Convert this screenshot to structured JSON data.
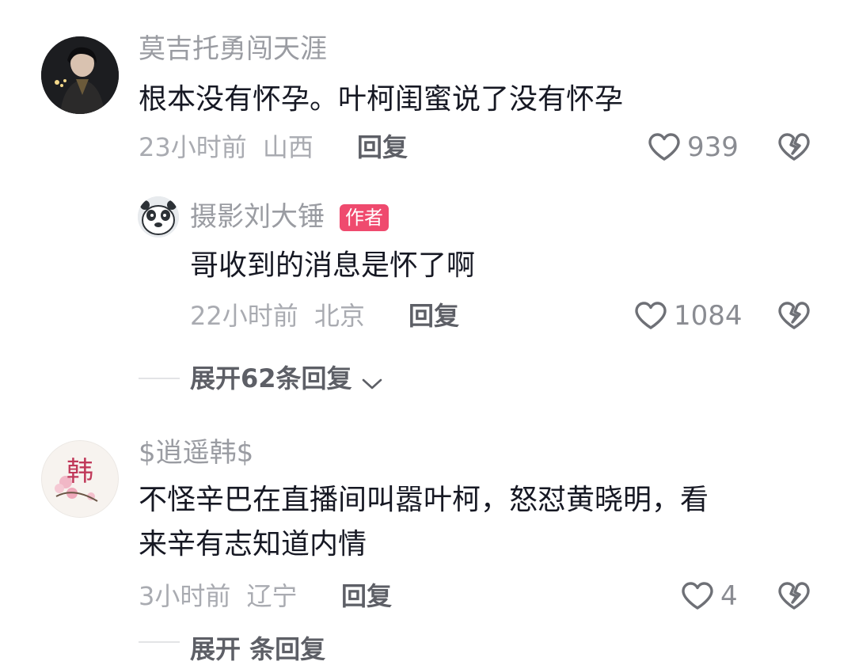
{
  "comments": [
    {
      "username": "莫吉托勇闯天涯",
      "text": "根本没有怀孕。叶柯闺蜜说了没有怀孕",
      "time": "23小时前",
      "location": "山西",
      "reply_label": "回复",
      "likes": "939",
      "replies": [
        {
          "username": "摄影刘大锤",
          "badge": "作者",
          "text": "哥收到的消息是怀了啊",
          "time": "22小时前",
          "location": "北京",
          "reply_label": "回复",
          "likes": "1084"
        }
      ],
      "expand_label": "展开62条回复"
    },
    {
      "username": "$逍遥韩$",
      "avatar_text": "韩",
      "text_line1": "不怪辛巴在直播间叫嚣叶柯，怒怼黄晓明，看",
      "text_line2": "来辛有志知道内情",
      "time": "3小时前",
      "location": "辽宁",
      "reply_label": "回复",
      "likes": "4"
    }
  ],
  "bottom_partial": "展开 条回复",
  "colors": {
    "author_badge": "#ef4a6e",
    "text_primary": "#161823",
    "text_secondary": "#9a9ca2"
  }
}
